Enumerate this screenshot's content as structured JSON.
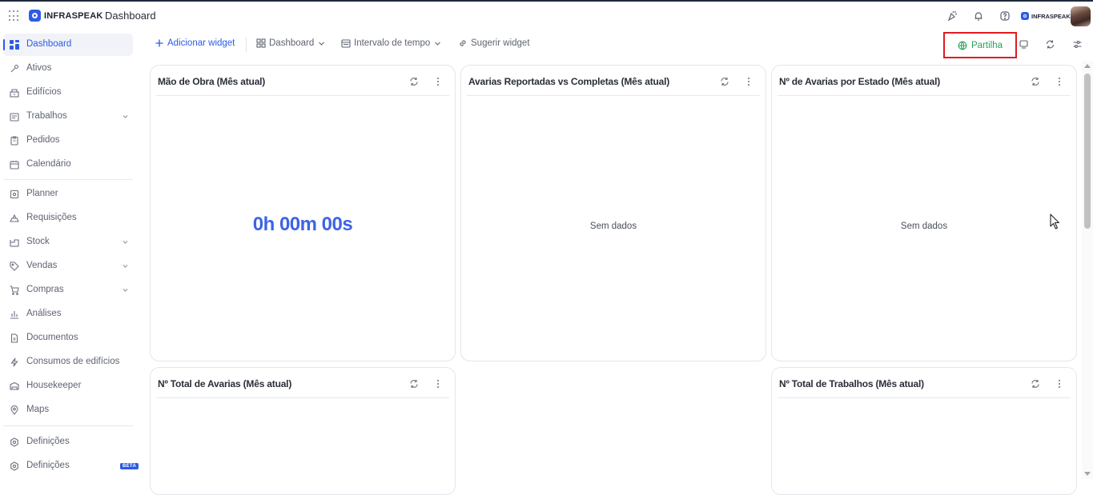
{
  "app": {
    "logo_text": "INFRASPEAK",
    "page_title": "Dashboard"
  },
  "header_right": {
    "logo_text": "INFRASPEAK"
  },
  "sidebar": {
    "items": [
      {
        "label": "Dashboard",
        "icon": "grid-icon",
        "active": true
      },
      {
        "label": "Ativos",
        "icon": "tool-icon"
      },
      {
        "label": "Edifícios",
        "icon": "building-icon"
      },
      {
        "label": "Trabalhos",
        "icon": "calendar-list-icon",
        "expandable": true
      },
      {
        "label": "Pedidos",
        "icon": "clipboard-icon"
      },
      {
        "label": "Calendário",
        "icon": "calendar-icon"
      },
      {
        "label": "Planner",
        "icon": "planner-icon"
      },
      {
        "label": "Requisições",
        "icon": "requisition-icon"
      },
      {
        "label": "Stock",
        "icon": "stock-icon",
        "expandable": true
      },
      {
        "label": "Vendas",
        "icon": "tag-icon",
        "expandable": true
      },
      {
        "label": "Compras",
        "icon": "cart-icon",
        "expandable": true
      },
      {
        "label": "Análises",
        "icon": "bar-chart-icon"
      },
      {
        "label": "Documentos",
        "icon": "document-icon"
      },
      {
        "label": "Consumos de edifícios",
        "icon": "lightning-icon"
      },
      {
        "label": "Housekeeper",
        "icon": "bed-icon"
      },
      {
        "label": "Maps",
        "icon": "map-pin-icon"
      },
      {
        "label": "Definições",
        "icon": "settings-icon"
      },
      {
        "label": "Definições",
        "icon": "settings-icon",
        "badge": "BETA"
      }
    ]
  },
  "toolbar": {
    "add_widget": "Adicionar widget",
    "dashboard_select": "Dashboard",
    "time_interval": "Intervalo de tempo",
    "suggest_widget": "Sugerir widget",
    "share": "Partilha"
  },
  "widgets": [
    {
      "title": "Mão de Obra (Mês atual)",
      "value": "0h 00m 00s"
    },
    {
      "title": "Avarias Reportadas vs Completas (Mês atual)",
      "empty_text": "Sem dados"
    },
    {
      "title": "Nº de Avarias por Estado (Mês atual)",
      "empty_text": "Sem dados"
    },
    {
      "title": "Nº Total de Avarias (Mês atual)"
    },
    {
      "title": "Nº Total de Trabalhos (Mês atual)"
    }
  ],
  "colors": {
    "accent": "#2d5be3",
    "share_green": "#2aa15b",
    "highlight_red": "#e11b22"
  }
}
